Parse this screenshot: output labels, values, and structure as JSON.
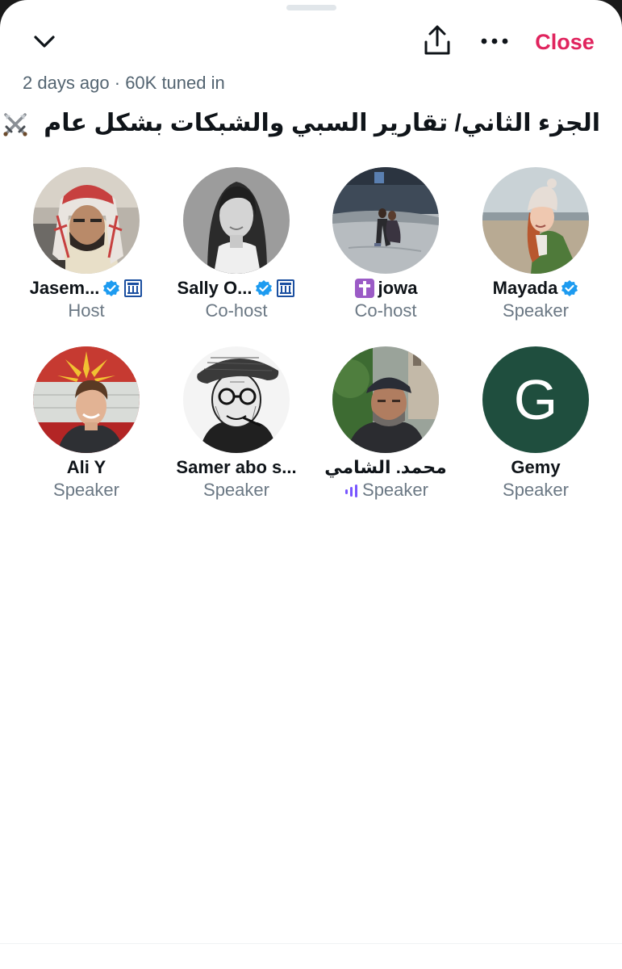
{
  "header": {
    "close_label": "Close"
  },
  "space": {
    "meta": "2 days ago · 60K tuned in",
    "title": "الجزء الثاني/ تقارير السبي والشبكات بشكل عام"
  },
  "participants": [
    {
      "name": "Jasem...",
      "role": "Host",
      "verified": true,
      "gov_badge": true,
      "avatar_icon": "man-with-keffiyeh-photo"
    },
    {
      "name": "Sally O...",
      "role": "Co-host",
      "verified": true,
      "gov_badge": true,
      "avatar_icon": "woman-portrait-bw-photo"
    },
    {
      "name": "jowa",
      "role": "Co-host",
      "prefix_emoji": "✝️",
      "avatar_icon": "couple-on-beach-photo"
    },
    {
      "name": "Mayada",
      "role": "Speaker",
      "verified": true,
      "avatar_icon": "woman-in-beanie-photo"
    },
    {
      "name": "Ali Y",
      "role": "Speaker",
      "avatar_icon": "young-man-flag-photo"
    },
    {
      "name": "Samer abo s...",
      "role": "Speaker",
      "avatar_icon": "man-sketch-drawing"
    },
    {
      "name": "محمد. الشامي",
      "role": "Speaker",
      "speaking": true,
      "avatar_icon": "man-with-cap-photo"
    },
    {
      "name": "Gemy",
      "role": "Speaker",
      "avatar_letter": "G",
      "avatar_color": "#1f4e3e"
    }
  ],
  "colors": {
    "close": "#e0245e",
    "verified": "#1d9bf0",
    "speaking": "#7856ff",
    "role_text": "#6b7884"
  }
}
